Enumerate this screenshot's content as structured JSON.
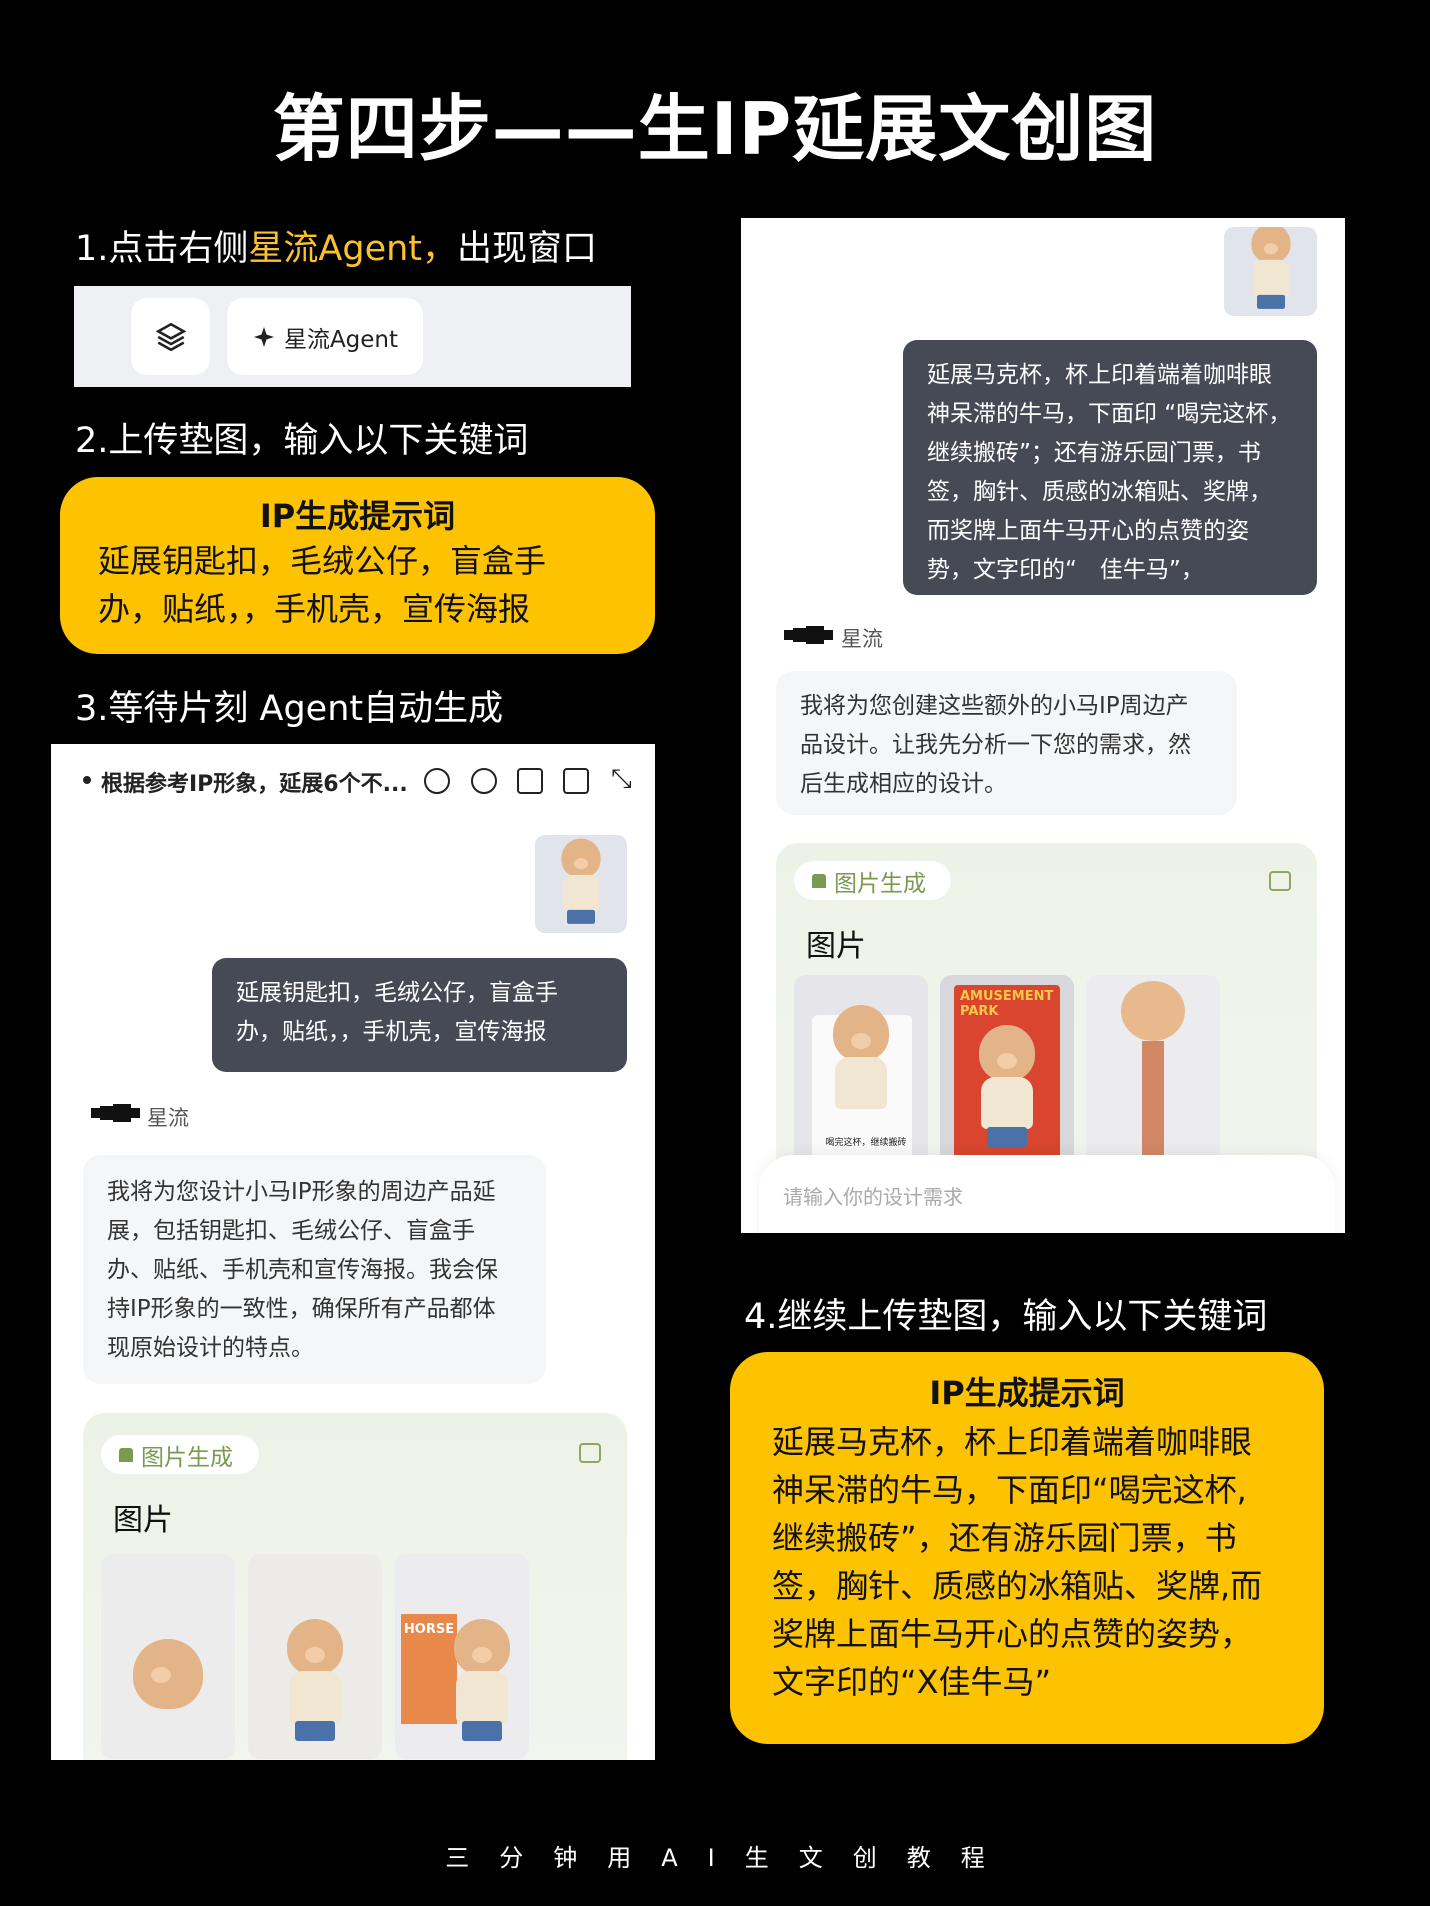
{
  "title": "第四步——生IP延展文创图",
  "step1": {
    "prefix": "1.点击右侧",
    "highlight": "星流Agent，",
    "suffix": "出现窗口",
    "layers_icon": "layers-icon",
    "agent_button": "星流Agent",
    "agent_icon": "sparkle-icon"
  },
  "step2": {
    "label": "2.上传垫图，输入以下关键词"
  },
  "prompt1": {
    "title": "IP生成提示词",
    "lines": [
      "延展钥匙扣，毛绒公仔，盲盒手",
      "办，贴纸，，手机壳，宣传海报"
    ]
  },
  "step3": {
    "label": "3.等待片刻 Agent自动生成"
  },
  "left_panel": {
    "header_title": "根据参考IP形象，延展6个不...",
    "header_icons": [
      "add-chat-icon",
      "history-icon",
      "share-icon",
      "file-search-icon",
      "collapse-icon"
    ],
    "user_lines": [
      "延展钥匙扣，毛绒公仔，盲盒手",
      "办，贴纸，，手机壳，宣传海报"
    ],
    "agent_name": "星流",
    "reply_lines": [
      "我将为您设计小马IP形象的周边产品延",
      "展，包括钥匙扣、毛绒公仔、盲盒手",
      "办、贴纸、手机壳和宣传海报。我会保",
      "持IP形象的一致性，确保所有产品都体",
      "现原始设计的特点。"
    ],
    "card_tag": "图片生成",
    "card_title": "图片",
    "thumb_labels": [
      "",
      "",
      "HORSE"
    ]
  },
  "right_panel": {
    "user_lines": [
      "延展马克杯，杯上印着端着咖啡眼",
      "神呆滞的牛马，下面印 “喝完这杯，",
      "继续搬砖”；还有游乐园门票，书",
      "签，胸针、质感的冰箱贴、奖牌，",
      "而奖牌上面牛马开心的点赞的姿",
      "势，文字印的“　佳牛马”，"
    ],
    "agent_name": "星流",
    "reply_lines": [
      "我将为您创建这些额外的小马IP周边产",
      "品设计。让我先分析一下您的需求，然",
      "后生成相应的设计。"
    ],
    "card_tag": "图片生成",
    "card_title": "图片",
    "thumb_labels": [
      "喝完这杯，继续搬砖",
      "AMUSEMENT PARK",
      ""
    ],
    "input_placeholder": "请输入你的设计需求"
  },
  "step4": {
    "label": "4.继续上传垫图，输入以下关键词"
  },
  "prompt2": {
    "title": "IP生成提示词",
    "lines": [
      "延展马克杯，杯上印着端着咖啡眼",
      "神呆滞的牛马，下面印“喝完这杯,",
      "继续搬砖”，还有游乐园门票，书",
      "签，胸针、质感的冰箱贴、奖牌,而",
      "奖牌上面牛马开心的点赞的姿势，",
      "文字印的“X佳牛马”"
    ]
  },
  "footer": "三分钟用AI生文创教程",
  "colors": {
    "accent_yellow": "#fdc200",
    "highlight": "#fdc12c",
    "bubble": "#454a55",
    "tag_green": "#7a9a52"
  }
}
